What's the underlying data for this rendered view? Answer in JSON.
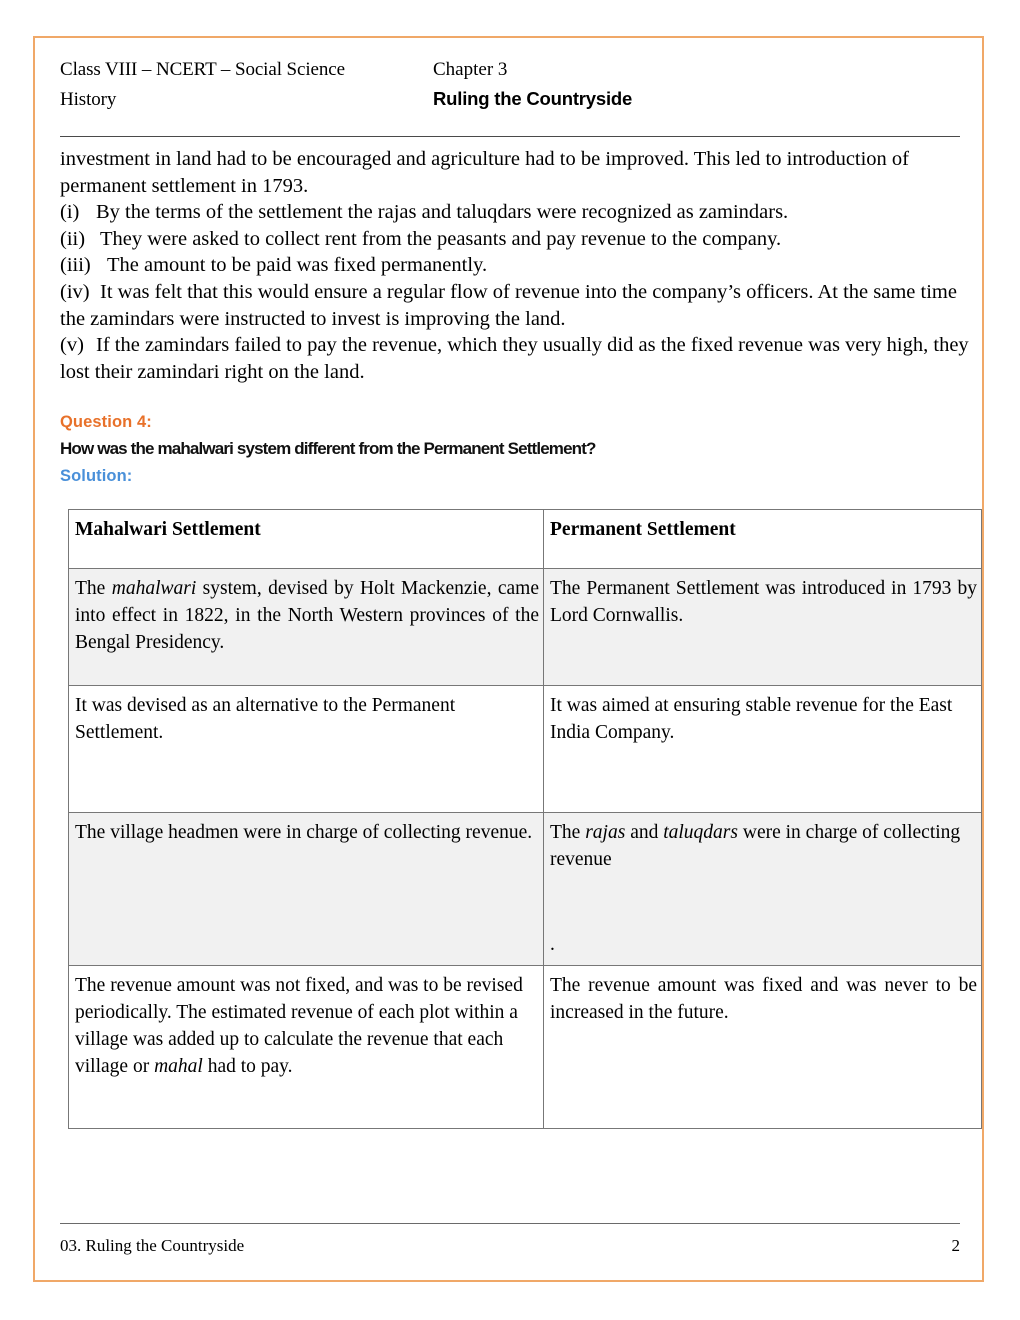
{
  "header": {
    "course_line": "Class VIII – NCERT – Social Science",
    "chapter_label": "Chapter 3",
    "subject": "History",
    "chapter_title": "Ruling the Countryside"
  },
  "body": {
    "intro_paragraph": "investment in land had to be encouraged and agriculture had to be improved. This led to introduction of permanent settlement in 1793.",
    "points": [
      {
        "marker": "(i)",
        "text": "By the terms of the settlement the rajas and taluqdars were recognized as   zamindars."
      },
      {
        "marker": "(ii)",
        "text": "They were asked to collect rent from the peasants and pay revenue to the   company."
      },
      {
        "marker": "(iii)",
        "text": "The amount to be paid was fixed   permanently."
      },
      {
        "marker": "(iv)",
        "text": "It was felt that this would ensure a regular flow of revenue into the company’s officers. At the same time  the zamindars were instructed to invest is improving the   land."
      },
      {
        "marker": "(v)",
        "text": "If the zamindars failed to pay the revenue, which they usually did as the fixed revenue was very high, they lost their zamindari right on the   land."
      }
    ]
  },
  "question": {
    "label": "Question 4:",
    "text": "How was the mahalwari system different from the Permanent Settlement?",
    "solution_label": "Solution:",
    "label_color": "#E8712A",
    "solution_color": "#4A90D9"
  },
  "table": {
    "headers": [
      "Mahalwari Settlement",
      "Permanent Settlement"
    ],
    "rows": [
      {
        "shaded": true,
        "left_pre": "The ",
        "left_em": "mahalwari",
        "left_post": " system, devised by Holt Mackenzie, came into effect in 1822, in the North Western provinces of the Bengal  Presidency.",
        "right": "The Permanent Settlement was introduced in 1793 by Lord Cornwallis."
      },
      {
        "shaded": false,
        "left": "It was devised as an alternative to the Permanent Settlement.",
        "right": "It was aimed at ensuring stable revenue for the East India  Company."
      },
      {
        "shaded": true,
        "left": "The village headmen were in charge of collecting revenue.",
        "right_pre": "The ",
        "right_em1": "rajas",
        "right_mid": " and ",
        "right_em2": "taluqdars",
        "right_post": " were in charge of collecting revenue",
        "right_trailing_dot": "."
      },
      {
        "shaded": false,
        "left_pre": "The revenue amount was not fixed, and was to be revised periodically. The estimated revenue of each plot within a village was added up to calculate the revenue that each village or ",
        "left_em": "mahal",
        "left_post": " had to pay.",
        "right": "The revenue amount was fixed and was never to be increased in the  future."
      }
    ]
  },
  "footer": {
    "title": "03. Ruling the Countryside",
    "page_number": "2"
  }
}
